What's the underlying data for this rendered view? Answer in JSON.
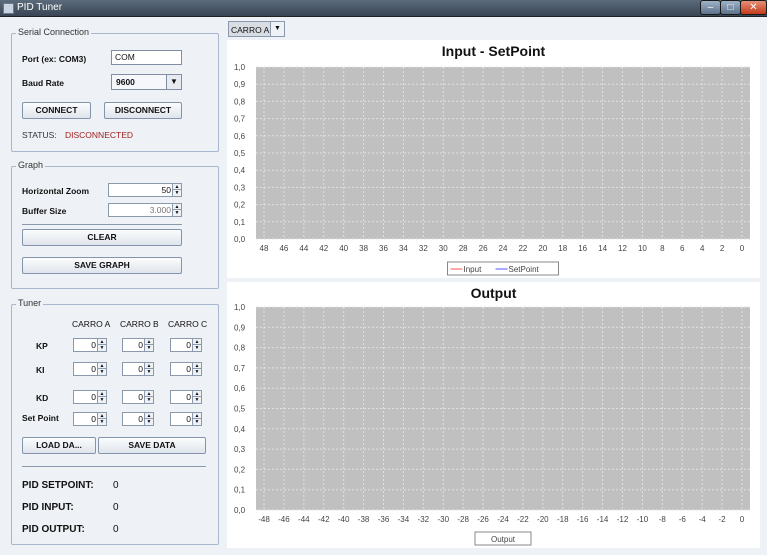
{
  "window": {
    "title": "PID Tuner"
  },
  "serial": {
    "legend": "Serial Connection",
    "port_label": "Port (ex: COM3)",
    "port_value": "COM",
    "baud_label": "Baud Rate",
    "baud_value": "9600",
    "connect_label": "CONNECT",
    "disconnect_label": "DISCONNECT",
    "status_label": "STATUS:",
    "status_value": "DISCONNECTED",
    "status_color": "#a01f1f"
  },
  "graph": {
    "legend": "Graph",
    "zoom_label": "Horizontal Zoom",
    "zoom_value": "50",
    "buffer_label": "Buffer Size",
    "buffer_value": "3.000",
    "clear_label": "CLEAR",
    "save_graph_label": "SAVE GRAPH"
  },
  "tuner": {
    "legend": "Tuner",
    "columns": [
      "CARRO A",
      "CARRO B",
      "CARRO C"
    ],
    "rows": [
      {
        "label": "KP",
        "values": [
          "0",
          "0",
          "0"
        ]
      },
      {
        "label": "KI",
        "values": [
          "0",
          "0",
          "0"
        ]
      },
      {
        "label": "KD",
        "values": [
          "0",
          "0",
          "0"
        ]
      },
      {
        "label": "Set Point",
        "values": [
          "0",
          "0",
          "0"
        ]
      }
    ],
    "load_label": "LOAD DA...",
    "save_label": "SAVE DATA",
    "pid_setpoint_label": "PID SETPOINT:",
    "pid_setpoint_value": "0",
    "pid_input_label": "PID INPUT:",
    "pid_input_value": "0",
    "pid_output_label": "PID OUTPUT:",
    "pid_output_value": "0"
  },
  "selector": {
    "value": "CARRO A"
  },
  "colors": {
    "plot_bg": "#c0c0c0",
    "grid": "#e2e2e2",
    "input_line": "#ff5555",
    "setpoint_line": "#5555ff"
  },
  "chart_data": [
    {
      "type": "line",
      "title": "Input - SetPoint",
      "x_ticks": [
        "48",
        "46",
        "44",
        "42",
        "40",
        "38",
        "36",
        "34",
        "32",
        "30",
        "28",
        "26",
        "24",
        "22",
        "20",
        "18",
        "16",
        "14",
        "12",
        "10",
        "8",
        "6",
        "4",
        "2",
        "0"
      ],
      "y_ticks": [
        "0,0",
        "0,1",
        "0,2",
        "0,3",
        "0,4",
        "0,5",
        "0,6",
        "0,7",
        "0,8",
        "0,9",
        "1,0"
      ],
      "ylim": [
        0,
        1
      ],
      "xlim": [
        48,
        0
      ],
      "grid": true,
      "legend_position": "bottom",
      "series": [
        {
          "name": "Input",
          "values": []
        },
        {
          "name": "SetPoint",
          "values": []
        }
      ]
    },
    {
      "type": "line",
      "title": "Output",
      "x_ticks": [
        "-48",
        "-46",
        "-44",
        "-42",
        "-40",
        "-38",
        "-36",
        "-34",
        "-32",
        "-30",
        "-28",
        "-26",
        "-24",
        "-22",
        "-20",
        "-18",
        "-16",
        "-14",
        "-12",
        "-10",
        "-8",
        "-6",
        "-4",
        "-2",
        "0"
      ],
      "y_ticks": [
        "0,0",
        "0,1",
        "0,2",
        "0,3",
        "0,4",
        "0,5",
        "0,6",
        "0,7",
        "0,8",
        "0,9",
        "1,0"
      ],
      "ylim": [
        0,
        1
      ],
      "xlim": [
        -48,
        0
      ],
      "grid": true,
      "legend_position": "bottom",
      "series": [
        {
          "name": "Output",
          "values": []
        }
      ]
    }
  ]
}
